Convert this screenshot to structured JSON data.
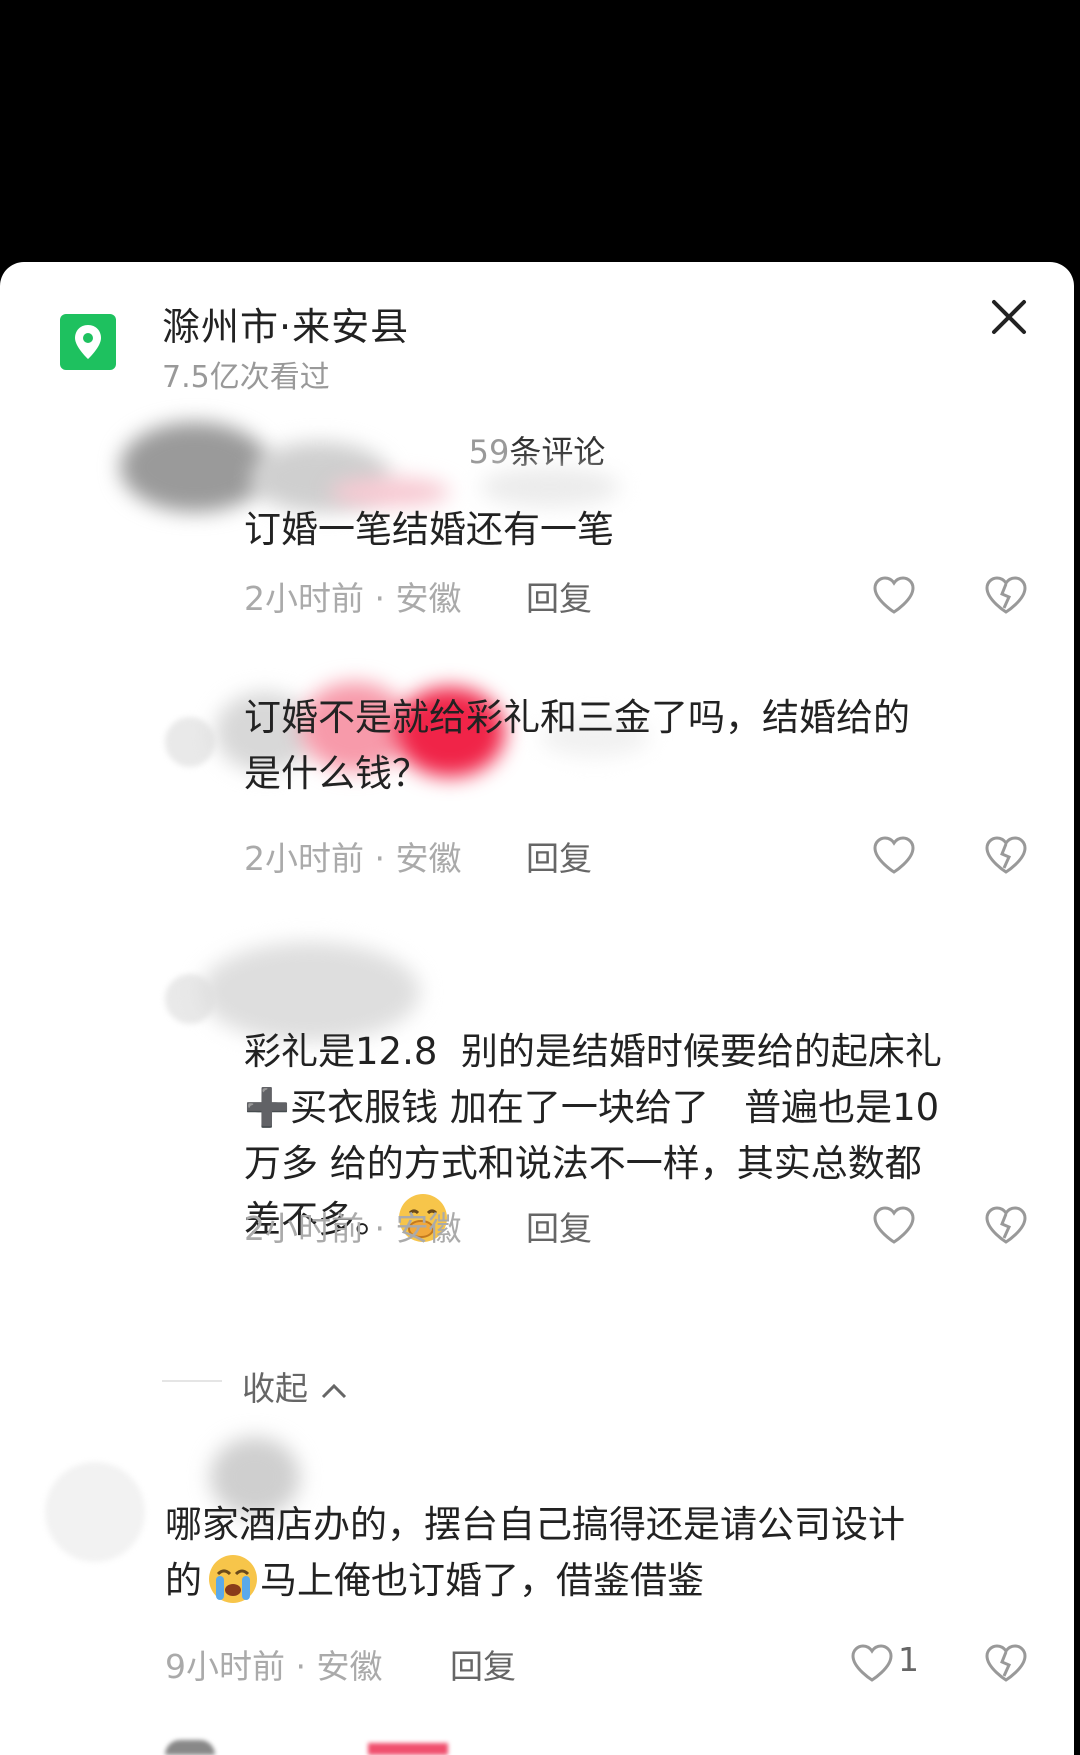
{
  "location": {
    "title": "滁州市·来安县",
    "views": "7.5亿次看过",
    "icon": "location-pin-icon"
  },
  "close_icon": "close-icon",
  "comments_header": {
    "count": "59",
    "label": "条评论"
  },
  "comments": [
    {
      "text": "订婚一笔结婚还有一笔",
      "time_location": "2小时前 · 安徽",
      "reply_label": "回复"
    },
    {
      "text": "订婚不是就给彩礼和三金了吗，结婚给的\n是什么钱？",
      "time_location": "2小时前 · 安徽",
      "reply_label": "回复"
    },
    {
      "text_part1": "彩礼是12.8  别的是结婚时候要给的起床礼\n➕买衣服钱 加在了一块给了   普遍也是10\n万多 给的方式和说法不一样，其实总数都\n差不多。",
      "time_location": "2小时前 · 安徽",
      "reply_label": "回复",
      "emoji": "hand-over-mouth-emoji"
    },
    {
      "text_part1": "哪家酒店办的，摆台自己搞得还是请公司设计\n的",
      "text_part2": "马上俺也订婚了，借鉴借鉴",
      "time_location": "9小时前 · 安徽",
      "reply_label": "回复",
      "like_count": "1",
      "emoji": "loudly-crying-emoji"
    }
  ],
  "collapse_label": "收起",
  "colors": {
    "accent_green": "#1ec15f",
    "text_primary": "#222222",
    "text_secondary": "#aaaaaa"
  }
}
